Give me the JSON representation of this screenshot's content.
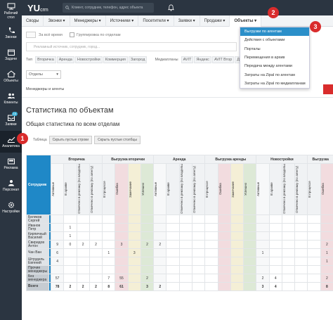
{
  "sidebar": {
    "items": [
      {
        "label": "Рабочий стол",
        "icon": "desktop-icon"
      },
      {
        "label": "Звонки",
        "icon": "phone-icon"
      },
      {
        "label": "Задачи",
        "icon": "calendar-icon"
      },
      {
        "label": "Объекты",
        "icon": "home-icon"
      },
      {
        "label": "Клиенты",
        "icon": "users-icon"
      },
      {
        "label": "Заявки",
        "icon": "inbox-icon",
        "badge": "16"
      },
      {
        "label": "Аналитика",
        "icon": "chart-icon"
      },
      {
        "label": "Реклама",
        "icon": "ads-icon"
      },
      {
        "label": "Персонал",
        "icon": "person-icon"
      },
      {
        "label": "Настройки",
        "icon": "gear-icon"
      }
    ]
  },
  "header": {
    "logo": "YU",
    "logo_sub": "crm",
    "search_placeholder": "Клиент, сотрудник, телефон, адрес объекта"
  },
  "nav": {
    "items": [
      "Своды",
      "Звонки ▾",
      "Менеджеры ▾",
      "Источники ▾",
      "Посетители ▾",
      "Заявки ▾",
      "Продажи ▾",
      "Объекты ▾"
    ]
  },
  "dropdown": {
    "items": [
      "Выгрузки по агентам",
      "Действия с объектами",
      "Порталы",
      "Перемещения в архив",
      "Передача между агентами",
      "Затраты на Zipal по агентам",
      "Затраты на Zipal по медиапланам"
    ]
  },
  "callouts": [
    "1",
    "2",
    "3"
  ],
  "filters": {
    "time_label": "За всё время",
    "group_label": "Группировка по отделам",
    "search_placeholder": "Рекламный источник, сотрудник, город...",
    "type_label": "Тип",
    "types": [
      "Вторичка",
      "Аренда",
      "Новостройки",
      "Коммерция",
      "Загород"
    ],
    "mediaplans_label": "Медиапланы",
    "mediaplans": [
      "AVIT",
      "Яндекс",
      "AVIT Втор",
      "Домо"
    ],
    "select_value": "Отделы",
    "managers_label": "Менеджеры и агенты"
  },
  "page": {
    "title": "Статистика по объектам",
    "section": "Общая статистика по всем отделам",
    "table_label": "Таблица",
    "show_empty_rows": "Скрыть пустые строки",
    "show_empty_cols": "Скрыть пустые столбцы"
  },
  "table": {
    "groups": [
      "Вторичка",
      "Выгрузка вторички",
      "Аренда",
      "Выгрузка аренды",
      "Новостройки",
      "Выгрузка"
    ],
    "employee_header": "Сотрудник",
    "col_headers": {
      "main": [
        "Активные",
        "В архиве",
        "Отмечено в рекламу (по владельцу объекта)",
        "Отмечено в рекламу (по агенту)"
      ],
      "unload": [
        "В процессе",
        "Ошибка",
        "Замечание",
        "Успешно"
      ]
    },
    "rows": [
      {
        "name": "Беляков Сергей",
        "cells": [
          "",
          "",
          "",
          "",
          "",
          "",
          "",
          "",
          "",
          "",
          "",
          "",
          "",
          "",
          "",
          "",
          "",
          "",
          "",
          "",
          "",
          ""
        ]
      },
      {
        "name": "Иванов Петр",
        "cells": [
          "",
          "1",
          "",
          "",
          "",
          "",
          "",
          "",
          "",
          "",
          "",
          "",
          "",
          "",
          "",
          "",
          "",
          "",
          "",
          "",
          "",
          ""
        ]
      },
      {
        "name": "Кирпичный Василий",
        "cells": [
          "",
          "1",
          "",
          "",
          "",
          "",
          "",
          "",
          "",
          "",
          "",
          "",
          "",
          "",
          "",
          "",
          "",
          "",
          "",
          "",
          "",
          ""
        ]
      },
      {
        "name": "Свиридов Антон",
        "cells": [
          "9",
          "0",
          "2",
          "2",
          "",
          "3",
          "",
          "2",
          "2",
          "",
          "",
          "",
          "",
          "",
          "",
          "",
          "",
          "",
          "",
          "",
          "",
          "2"
        ]
      },
      {
        "name": "Чан Ван",
        "cells": [
          "6",
          "",
          "",
          "",
          "1",
          "",
          "3",
          "",
          "",
          "",
          "",
          "",
          "",
          "",
          "",
          "",
          "1",
          "",
          "",
          "",
          "",
          "1"
        ]
      },
      {
        "name": "Штрудель Евгений",
        "cells": [
          "4",
          "",
          "",
          "",
          "",
          "",
          "",
          "",
          "",
          "",
          "",
          "",
          "",
          "",
          "",
          "",
          "",
          "",
          "",
          "",
          "",
          "1"
        ]
      },
      {
        "name": "Прочие менеджеры",
        "dark": true,
        "cells": [
          "",
          "",
          "",
          "",
          "",
          "",
          "",
          "",
          "",
          "",
          "",
          "",
          "",
          "",
          "",
          "",
          "",
          "",
          "",
          "",
          "",
          ""
        ]
      },
      {
        "name": "Без менеджера",
        "dark": true,
        "cells": [
          "57",
          "",
          "",
          "",
          "7",
          "55",
          "",
          "2",
          "",
          "",
          "",
          "",
          "",
          "",
          "",
          "",
          "2",
          "4",
          "",
          "",
          "",
          "2"
        ]
      },
      {
        "name": "Всего",
        "dark": true,
        "total": true,
        "cells": [
          "78",
          "2",
          "2",
          "2",
          "8",
          "61",
          "",
          "3",
          "2",
          "",
          "",
          "",
          "",
          "",
          "",
          "",
          "3",
          "4",
          "",
          "",
          "",
          "8"
        ]
      }
    ]
  }
}
